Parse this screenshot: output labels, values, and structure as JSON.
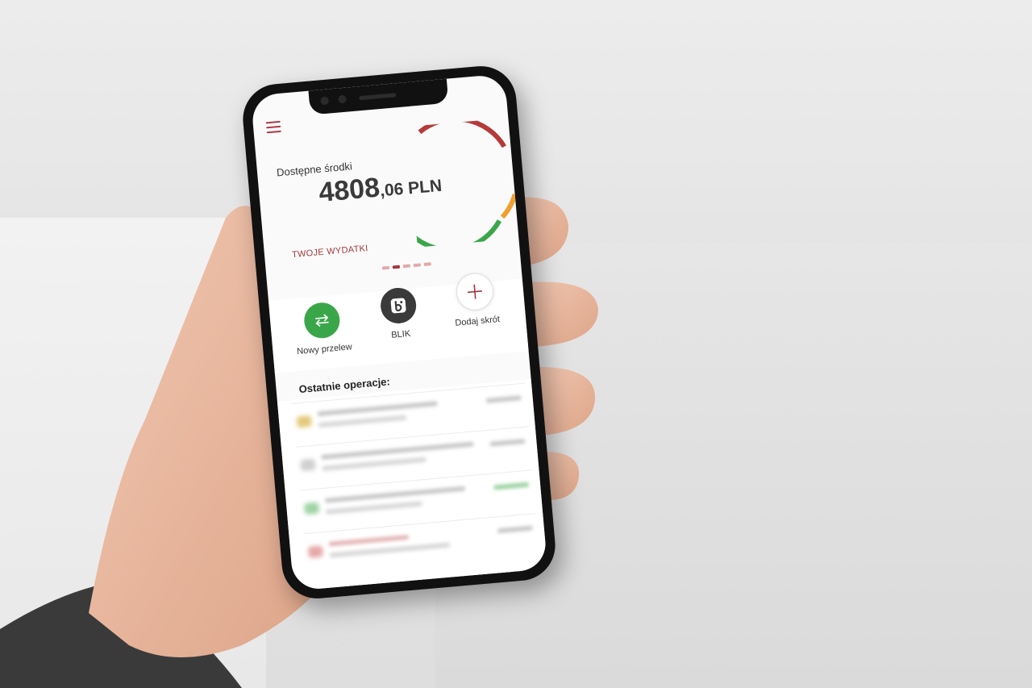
{
  "app": {
    "balance_label": "Dostępne środki",
    "balance_integer": "4808",
    "balance_decimal": ",06 PLN",
    "spending_link": "TWOJE WYDATKI",
    "carousel_pages": 5,
    "carousel_active_index": 1,
    "shortcuts": [
      {
        "label": "Nowy przelew",
        "icon": "transfer-arrows-icon"
      },
      {
        "label": "BLIK",
        "icon": "blik-icon"
      },
      {
        "label": "Dodaj skrót",
        "icon": "plus-icon"
      }
    ],
    "recent_title": "Ostatnie operacje:"
  },
  "colors": {
    "accent": "#a3383c",
    "ring_red": "#b73a3a",
    "ring_orange": "#f0a030",
    "ring_green": "#3aa64a",
    "button_green": "#3aa64a",
    "button_dark": "#3a3a3a"
  }
}
